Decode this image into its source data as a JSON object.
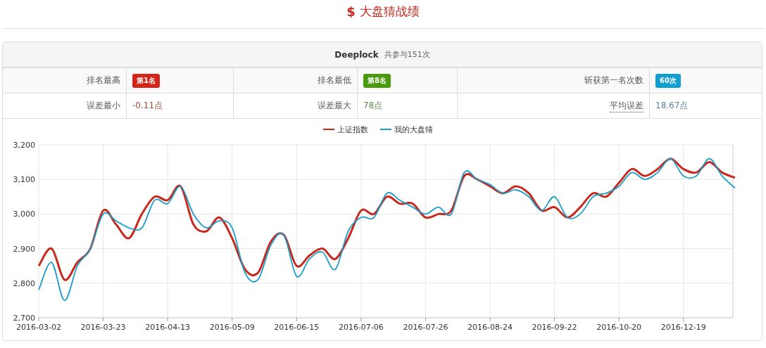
{
  "page_title": {
    "icon": "$",
    "text": "大盘猜战绩"
  },
  "panel": {
    "user": "Deeplock",
    "participation": "共参与151次",
    "stats": [
      [
        {
          "label": "排名最高",
          "value": "第1名",
          "kind": "badge",
          "color": "#d3261a",
          "tooltip": false
        },
        {
          "label": "排名最低",
          "value": "第8名",
          "kind": "badge",
          "color": "#4b9a0e",
          "tooltip": false
        },
        {
          "label": "斩获第一名次数",
          "value": "60次",
          "kind": "badge",
          "color": "#139ed0",
          "tooltip": false
        }
      ],
      [
        {
          "label": "误差最小",
          "value": "-0.11点",
          "kind": "text",
          "color": "#a94a35",
          "tooltip": false
        },
        {
          "label": "误差最大",
          "value": "78点",
          "kind": "text",
          "color": "#5b8a45",
          "tooltip": false
        },
        {
          "label": "平均误差",
          "value": "18.67点",
          "kind": "text",
          "color": "#5e7f9c",
          "tooltip": true
        }
      ]
    ],
    "chart_data": {
      "type": "line",
      "categories": [
        "2016-03-02",
        null,
        null,
        null,
        null,
        "2016-03-23",
        null,
        null,
        null,
        null,
        "2016-04-13",
        null,
        null,
        null,
        null,
        "2016-05-09",
        null,
        null,
        null,
        null,
        "2016-06-15",
        null,
        null,
        null,
        null,
        "2016-07-06",
        null,
        null,
        null,
        null,
        "2016-07-26",
        null,
        null,
        null,
        null,
        "2016-08-24",
        null,
        null,
        null,
        null,
        "2016-09-22",
        null,
        null,
        null,
        null,
        "2016-10-20",
        null,
        null,
        null,
        null,
        "2016-12-19",
        null,
        null,
        null,
        null
      ],
      "ylim": [
        2700,
        3200
      ],
      "grid": true,
      "legend": "top",
      "yticks": [
        {
          "value": 2700,
          "label": "2,700"
        },
        {
          "value": 2800,
          "label": "2,800"
        },
        {
          "value": 2900,
          "label": "2,900"
        },
        {
          "value": 3000,
          "label": "3,000"
        },
        {
          "value": 3100,
          "label": "3,100"
        },
        {
          "value": 3200,
          "label": "3,200"
        }
      ],
      "series": [
        {
          "name": "上证指数",
          "color": "#c9281c",
          "values": [
            2850,
            2900,
            2810,
            2860,
            2900,
            3010,
            2970,
            2930,
            3000,
            3050,
            3040,
            3080,
            2970,
            2950,
            2990,
            2930,
            2840,
            2830,
            2920,
            2940,
            2850,
            2880,
            2900,
            2870,
            2930,
            3010,
            3000,
            3050,
            3030,
            3030,
            2990,
            3000,
            3010,
            3110,
            3100,
            3080,
            3060,
            3080,
            3060,
            3010,
            3020,
            2990,
            3020,
            3060,
            3050,
            3090,
            3130,
            3110,
            3130,
            3160,
            3130,
            3120,
            3150,
            3120,
            3105
          ]
        },
        {
          "name": "我的大盘猜",
          "color": "#1b9dc9",
          "values": [
            2780,
            2860,
            2750,
            2850,
            2900,
            3000,
            2980,
            2960,
            2960,
            3040,
            3030,
            3080,
            3000,
            2960,
            2980,
            2960,
            2830,
            2810,
            2910,
            2940,
            2820,
            2870,
            2890,
            2840,
            2950,
            2990,
            2990,
            3060,
            3040,
            3020,
            3000,
            3020,
            3000,
            3120,
            3100,
            3085,
            3060,
            3070,
            3050,
            3010,
            3050,
            2990,
            3000,
            3050,
            3060,
            3080,
            3120,
            3100,
            3120,
            3160,
            3110,
            3110,
            3160,
            3110,
            3075
          ]
        }
      ]
    }
  }
}
